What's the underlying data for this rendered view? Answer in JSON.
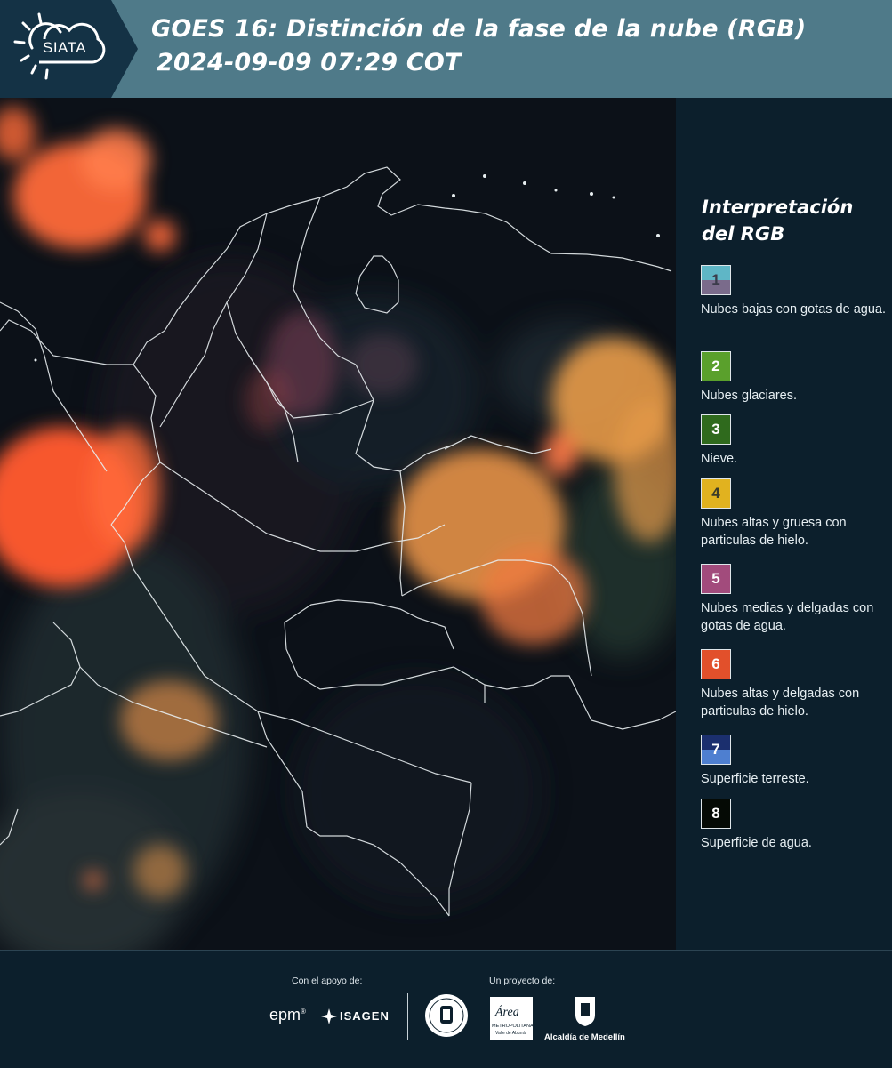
{
  "header": {
    "logo_text": "SIATA",
    "title_line1": "GOES 16: Distinción de la fase de la nube (RGB)",
    "title_line2": "2024-09-09 07:29 COT"
  },
  "legend": {
    "title_line1": "Interpretación",
    "title_line2": "del RGB",
    "items": [
      {
        "num": "1",
        "label": "Nubes bajas con gotas de agua.",
        "top_color": "#5fb6c6",
        "bottom_color": "#7a6b8b",
        "num_color": "#3b3b4a"
      },
      {
        "num": "2",
        "label": "Nubes glaciares.",
        "top_color": "#5aa02c",
        "bottom_color": "#5aa02c",
        "num_color": "#ffffff"
      },
      {
        "num": "3",
        "label": "Nieve.",
        "top_color": "#2f6a1d",
        "bottom_color": "#2f6a1d",
        "num_color": "#ffffff"
      },
      {
        "num": "4",
        "label": "Nubes altas y gruesa con particulas de hielo.",
        "top_color": "#e1b21f",
        "bottom_color": "#e1b21f",
        "num_color": "#3b3b2a"
      },
      {
        "num": "5",
        "label": "Nubes medias y delgadas con gotas de agua.",
        "top_color": "#a24b7c",
        "bottom_color": "#a24b7c",
        "num_color": "#ffffff"
      },
      {
        "num": "6",
        "label": "Nubes altas y delgadas con particulas de hielo.",
        "top_color": "#e2502b",
        "bottom_color": "#e2502b",
        "num_color": "#ffffff"
      },
      {
        "num": "7",
        "label": "Superficie terreste.",
        "top_color": "#1b2f6e",
        "bottom_color": "#4e7fd0",
        "num_color": "#ffffff"
      },
      {
        "num": "8",
        "label": "Superficie de agua.",
        "top_color": "#050a05",
        "bottom_color": "#050a05",
        "num_color": "#ffffff"
      }
    ]
  },
  "footer": {
    "support_label": "Con el apoyo de:",
    "project_label": "Un proyecto de:",
    "epm_text": "epm",
    "isagen_text": "ISAGEN",
    "area_text": "Área",
    "area_sub1": "METROPOLITANA",
    "area_sub2": "Valle de Aburrá",
    "alcaldia_text": "Alcaldía de Medellín"
  },
  "colors": {
    "header_bg": "#4f7a89",
    "page_bg": "#0c1f2c"
  }
}
